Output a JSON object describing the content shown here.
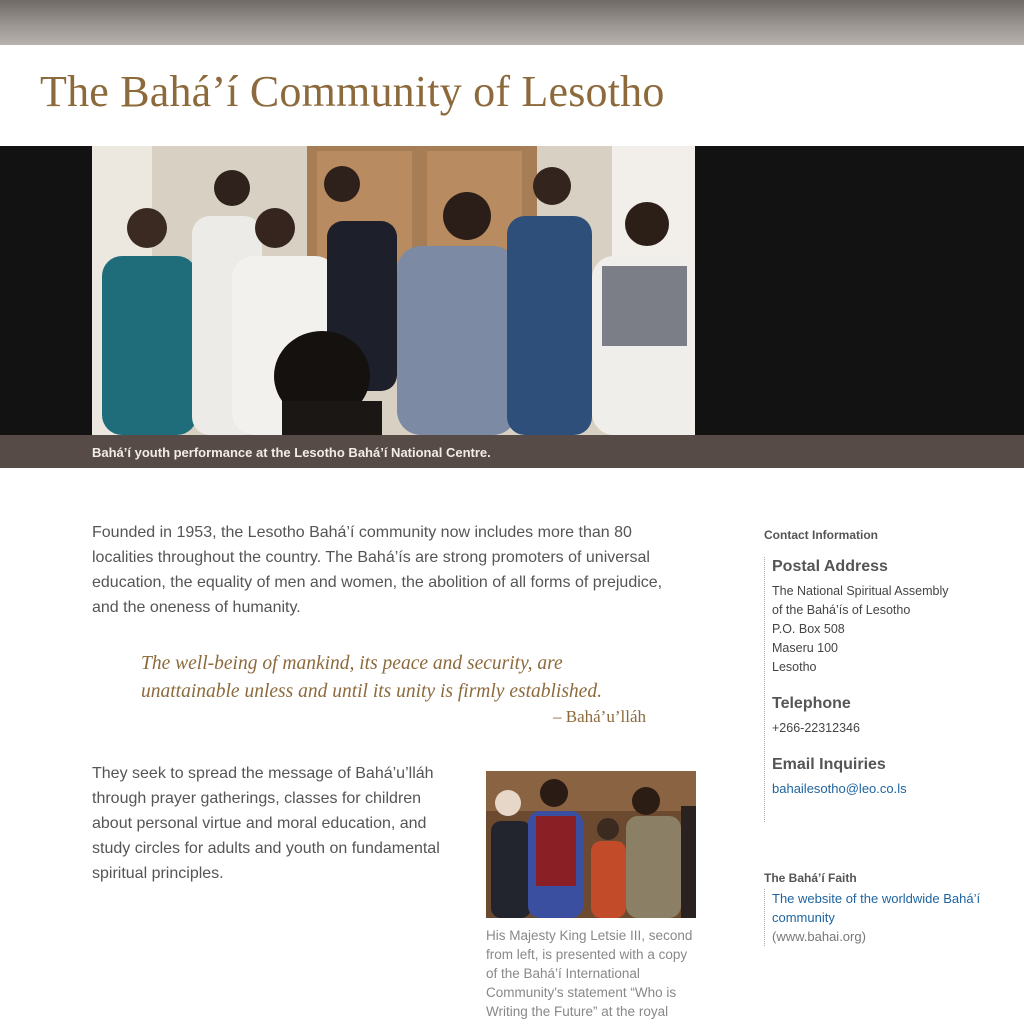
{
  "site": {
    "title": "The Bahá’í Community of Lesotho"
  },
  "hero": {
    "image_alt": "Bahá’í youth performance at the Lesotho Bahá’í National Centre.",
    "caption": "Bahá’í youth performance at the Lesotho Bahá’í National Centre."
  },
  "main": {
    "intro": "Founded in 1953, the Lesotho Bahá’í community now includes more than 80 localities throughout the country. The Bahá’ís are strong promoters of universal education, the equality of men and women, the abolition of all forms of prejudice, and the oneness of humanity.",
    "quote": "The well-being of mankind, its peace and security, are unattainable unless and until its unity is firmly established.",
    "quote_attribution": "– Bahá’u’lláh",
    "body2": "They seek to spread the message of Bahá’u’lláh through prayer gatherings, classes for children about personal virtue and moral education, and study circles for adults and youth on fundamental spiritual principles.",
    "inline_caption": "His Majesty King Letsie III, second from left, is presented with a copy of the Bahá’í International Community's statement “Who is Writing the Future” at the royal"
  },
  "sidebar": {
    "heading": "Contact Information",
    "postal": {
      "title": "Postal Address",
      "lines": [
        "The National Spiritual Assembly",
        "of the Bahá’ís of Lesotho",
        "P.O. Box 508",
        "Maseru 100",
        "Lesotho"
      ]
    },
    "telephone": {
      "title": "Telephone",
      "number": "+266-22312346"
    },
    "email": {
      "title": "Email Inquiries",
      "address": "bahailesotho@leo.co.ls"
    },
    "faith": {
      "heading": "The Bahá’í Faith",
      "link_text": "The website of the worldwide Bahá’í community",
      "url_text": "(www.bahai.org)"
    }
  },
  "colors": {
    "title_brown": "#8c6a3c",
    "caption_bar": "#574b47",
    "link_blue": "#1e64a0"
  }
}
